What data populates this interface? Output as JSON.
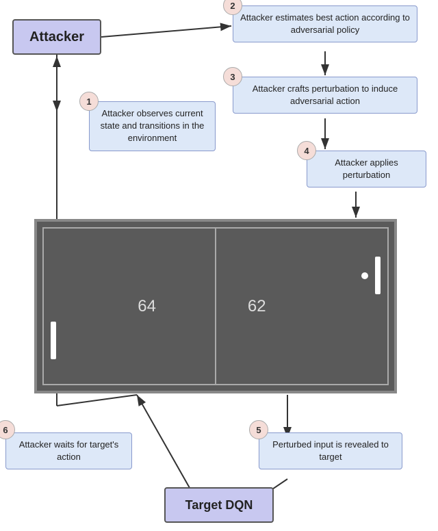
{
  "attacker": {
    "label": "Attacker"
  },
  "target": {
    "label": "Target DQN"
  },
  "steps": {
    "step1": {
      "number": "1",
      "text": "Attacker observes current state and transitions in the environment"
    },
    "step2": {
      "number": "2",
      "text": "Attacker estimates best action according to adversarial policy"
    },
    "step3": {
      "number": "3",
      "text": "Attacker crafts perturbation to induce adversarial action"
    },
    "step4": {
      "number": "4",
      "text": "Attacker applies perturbation"
    },
    "step5": {
      "number": "5",
      "text": "Perturbed input is revealed to target"
    },
    "step6": {
      "number": "6",
      "text": "Attacker waits for target's action"
    }
  },
  "pong": {
    "score_left": "64",
    "score_right": "62"
  }
}
